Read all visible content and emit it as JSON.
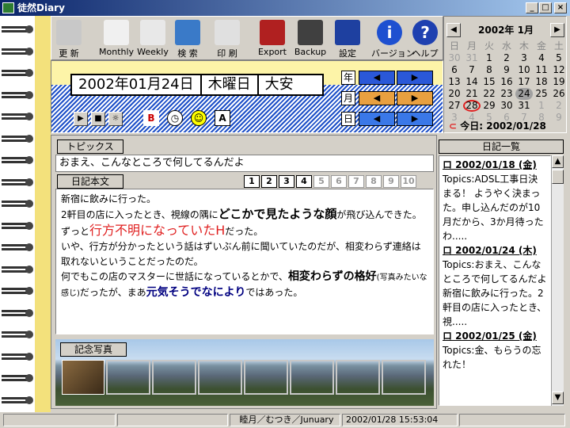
{
  "window": {
    "title": "徒然Diary"
  },
  "toolbar": {
    "buttons": [
      {
        "label": "更 新",
        "icon": "update-icon"
      },
      {
        "label": "Monthly",
        "icon": "monthly-icon"
      },
      {
        "label": "Weekly",
        "icon": "weekly-icon"
      },
      {
        "label": "検 索",
        "icon": "search-icon"
      },
      {
        "label": "印 刷",
        "icon": "print-icon"
      },
      {
        "label": "Export",
        "icon": "export-icon"
      },
      {
        "label": "Backup",
        "icon": "backup-icon"
      },
      {
        "label": "設定",
        "icon": "settings-icon"
      },
      {
        "label": "バージョン",
        "icon": "version-info-icon"
      },
      {
        "label": "ヘルプ",
        "icon": "help-icon"
      }
    ]
  },
  "date_panel": {
    "date": "2002年01月24日",
    "weekday": "木曜日",
    "rokuyo": "大安",
    "year_label": "年",
    "month_label": "月",
    "day_label": "日",
    "prev": "◀",
    "next": "▶"
  },
  "calendar": {
    "header": "2002年 1月",
    "prev": "◀",
    "next": "▶",
    "weekdays": [
      "日",
      "月",
      "火",
      "水",
      "木",
      "金",
      "土"
    ],
    "days": [
      {
        "d": "30",
        "muted": true
      },
      {
        "d": "31",
        "muted": true
      },
      {
        "d": "1"
      },
      {
        "d": "2"
      },
      {
        "d": "3"
      },
      {
        "d": "4"
      },
      {
        "d": "5"
      },
      {
        "d": "6"
      },
      {
        "d": "7"
      },
      {
        "d": "8"
      },
      {
        "d": "9"
      },
      {
        "d": "10"
      },
      {
        "d": "11"
      },
      {
        "d": "12"
      },
      {
        "d": "13"
      },
      {
        "d": "14"
      },
      {
        "d": "15"
      },
      {
        "d": "16"
      },
      {
        "d": "17"
      },
      {
        "d": "18"
      },
      {
        "d": "19"
      },
      {
        "d": "20"
      },
      {
        "d": "21"
      },
      {
        "d": "22"
      },
      {
        "d": "23"
      },
      {
        "d": "24",
        "selected": true
      },
      {
        "d": "25"
      },
      {
        "d": "26"
      },
      {
        "d": "27"
      },
      {
        "d": "28",
        "today": true
      },
      {
        "d": "29"
      },
      {
        "d": "30"
      },
      {
        "d": "31"
      },
      {
        "d": "1",
        "muted": true
      },
      {
        "d": "2",
        "muted": true
      },
      {
        "d": "3",
        "muted": true
      },
      {
        "d": "4",
        "muted": true
      },
      {
        "d": "5",
        "muted": true
      },
      {
        "d": "6",
        "muted": true
      },
      {
        "d": "7",
        "muted": true
      },
      {
        "d": "8",
        "muted": true
      },
      {
        "d": "9",
        "muted": true
      }
    ],
    "today_text": "今日: 2002/01/28"
  },
  "topics": {
    "label": "トピックス",
    "value": "おまえ、こんなところで何してるんだよ"
  },
  "body": {
    "label": "日記本文",
    "pages": [
      "1",
      "2",
      "3",
      "4",
      "5",
      "6",
      "7",
      "8",
      "9",
      "10"
    ],
    "active_pages": 4,
    "segments": [
      [
        {
          "t": "新宿に飲みに行った。"
        }
      ],
      [
        {
          "t": "2軒目の店に入ったとき、視線の隅に"
        },
        {
          "t": "どこかで見たような顔",
          "style": "big"
        },
        {
          "t": "が飛び込んできた。"
        }
      ],
      [
        {
          "t": "ずっと"
        },
        {
          "t": "行方不明になっていたH",
          "style": "red"
        },
        {
          "t": "だった。"
        }
      ],
      [
        {
          "t": "いや、行方が分かったという話はずいぶん前に聞いていたのだが、相変わらず連絡は取れないということだったのだ。"
        }
      ],
      [
        {
          "t": "何でもこの店のマスターに世話になっているとかで、"
        },
        {
          "t": "相変わらずの格好",
          "style": "bold"
        },
        {
          "t": "(写真みたいな感じ)",
          "style": "small"
        },
        {
          "t": "だったが、まあ"
        },
        {
          "t": "元気そうでなにより",
          "style": "navy"
        },
        {
          "t": "ではあった。"
        }
      ]
    ]
  },
  "photo": {
    "label": "記念写真"
  },
  "diary_list": {
    "label": "日記一覧",
    "entries": [
      {
        "date": "ロ 2002/01/18 (金)",
        "text": "Topics:ADSL工事日決まる！ ようやく決まった。申し込んだのが10月だから、3か月待ったわ....."
      },
      {
        "date": "ロ 2002/01/24 (木)",
        "text": "Topics:おまえ、こんなところで何してるんだよ 新宿に飲みに行った。2軒目の店に入ったとき、視....."
      },
      {
        "date": "ロ 2002/01/25 (金)",
        "text": "Topics:金、もらうの忘れた！"
      }
    ]
  },
  "status": {
    "cells": [
      "",
      "",
      "睦月／むつき／Junuary",
      "2002/01/28 15:53:04",
      ""
    ]
  },
  "colors": {
    "accent_red": "#e02020",
    "navy": "#000080",
    "stripe_blue": "#1e50c8",
    "panel_yellow": "#fdf4a8"
  }
}
